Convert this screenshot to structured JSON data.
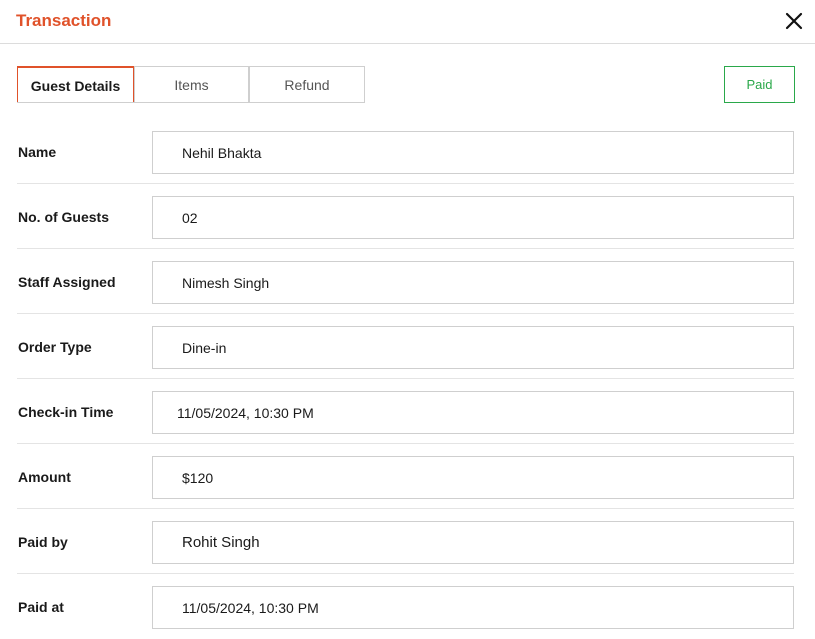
{
  "header": {
    "title": "Transaction",
    "close_icon": "close-icon"
  },
  "tabs": [
    {
      "label": "Guest Details",
      "active": true
    },
    {
      "label": "Items",
      "active": false
    },
    {
      "label": "Refund",
      "active": false
    }
  ],
  "status": {
    "label": "Paid",
    "color": "#2aa84a"
  },
  "fields": {
    "name": {
      "label": "Name",
      "value": "Nehil Bhakta"
    },
    "guests": {
      "label": "No. of Guests",
      "value": "02"
    },
    "staff": {
      "label": "Staff Assigned",
      "value": "Nimesh Singh"
    },
    "order_type": {
      "label": "Order Type",
      "value": "Dine-in"
    },
    "checkin": {
      "label": "Check-in Time",
      "value": "11/05/2024, 10:30 PM"
    },
    "amount": {
      "label": "Amount",
      "value": "$120"
    },
    "paid_by": {
      "label": "Paid by",
      "value": "Rohit Singh"
    },
    "paid_at": {
      "label": "Paid at",
      "value": "11/05/2024, 10:30 PM"
    }
  },
  "colors": {
    "accent": "#e0522a",
    "paid": "#2aa84a"
  }
}
